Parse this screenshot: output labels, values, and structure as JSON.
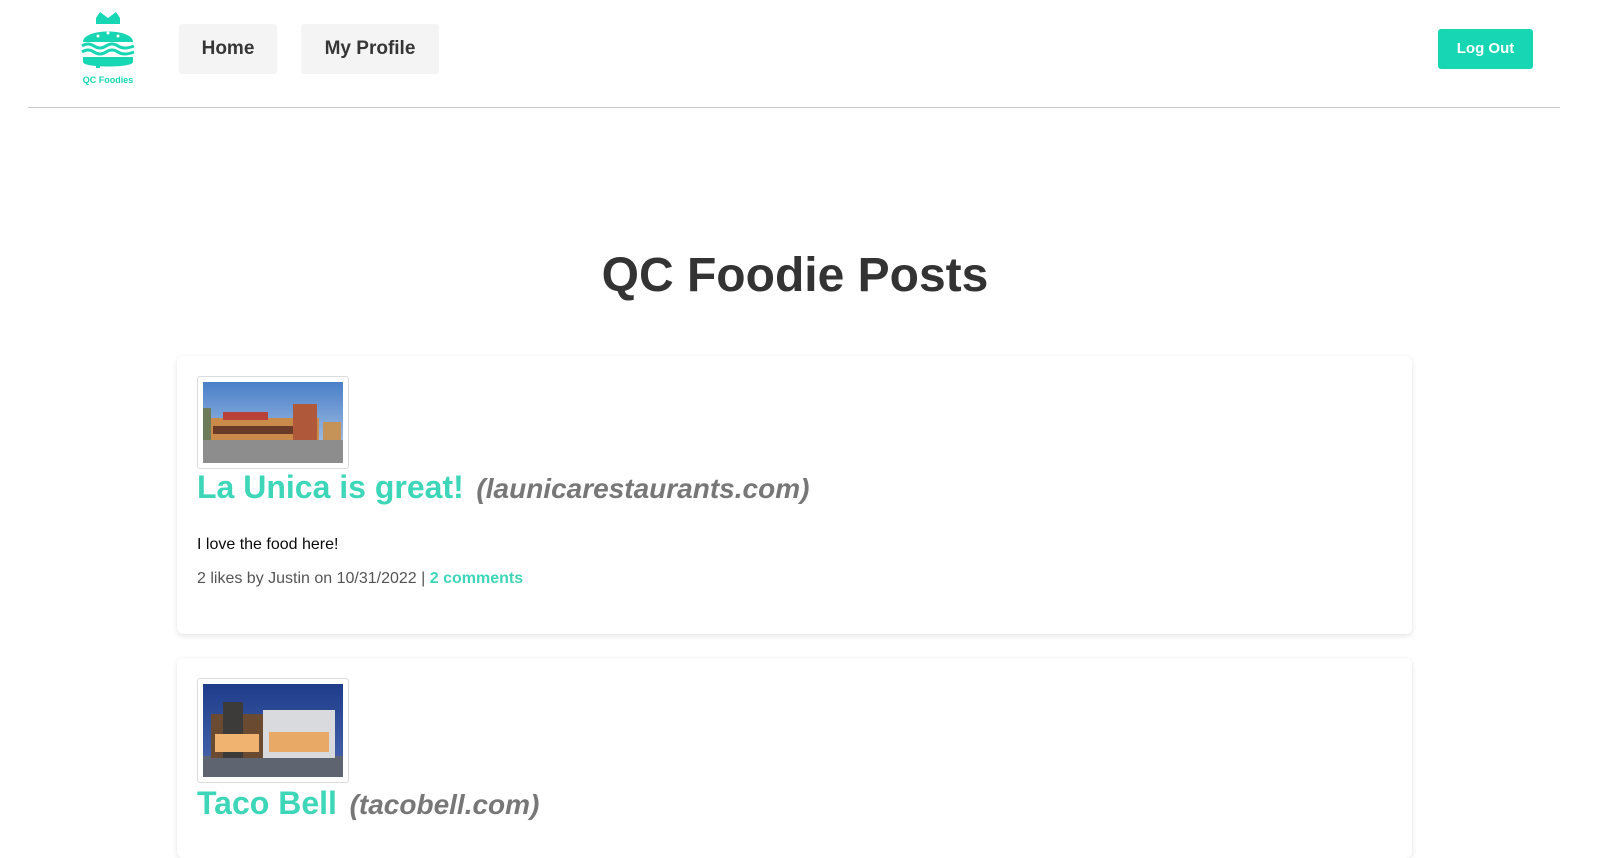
{
  "nav": {
    "logo_text": "QC Foodies",
    "home_label": "Home",
    "profile_label": "My Profile",
    "logout_label": "Log Out"
  },
  "colors": {
    "accent": "#16d6b4",
    "link": "#3ed6b8",
    "nav_button_bg": "#f4f4f4"
  },
  "page": {
    "title": "QC Foodie Posts"
  },
  "posts": [
    {
      "title": "La Unica is great!",
      "domain": "(launicarestaurants.com)",
      "body": "I love the food here!",
      "meta_prefix": "2 likes by Justin on 10/31/2022 |",
      "comments_label": "2 comments",
      "image_icon": "restaurant-photo"
    },
    {
      "title": "Taco Bell",
      "domain": "(tacobell.com)",
      "image_icon": "restaurant-photo"
    }
  ]
}
